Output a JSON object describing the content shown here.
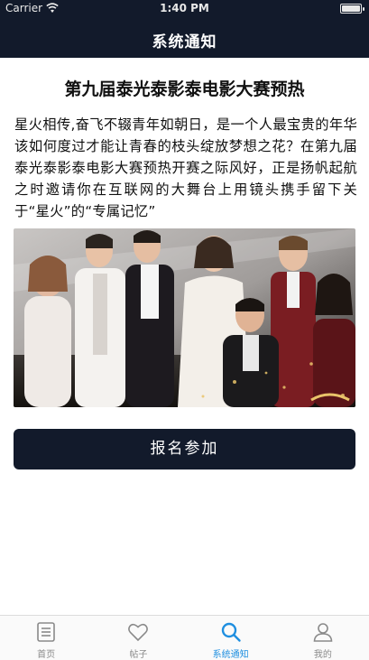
{
  "status_bar": {
    "carrier": "Carrier",
    "time": "1:40 PM",
    "battery_level": 1.0
  },
  "nav": {
    "title": "系统通知"
  },
  "article": {
    "title": "第九届泰光泰影泰电影大赛预热",
    "body": "星火相传,奋飞不辍青年如朝日，是一个人最宝贵的年华该如何度过才能让青春的枝头绽放梦想之花？在第九届泰光泰影泰电影大赛预热开赛之际风好，正是扬帆起航之时邀请你在互联网的大舞台上用镜头携手留下关于“星火”的“专属记忆”"
  },
  "actions": {
    "join_label": "报名参加"
  },
  "tabbar": {
    "items": [
      {
        "label": "首页",
        "icon": "home-list-icon",
        "active": false
      },
      {
        "label": "帖子",
        "icon": "heart-icon",
        "active": false
      },
      {
        "label": "系统通知",
        "icon": "search-icon",
        "active": true
      },
      {
        "label": "我的",
        "icon": "person-icon",
        "active": false
      }
    ]
  },
  "colors": {
    "header": "#121a2b",
    "accent": "#1f8fe0",
    "tab_inactive": "#8a8a8a"
  }
}
